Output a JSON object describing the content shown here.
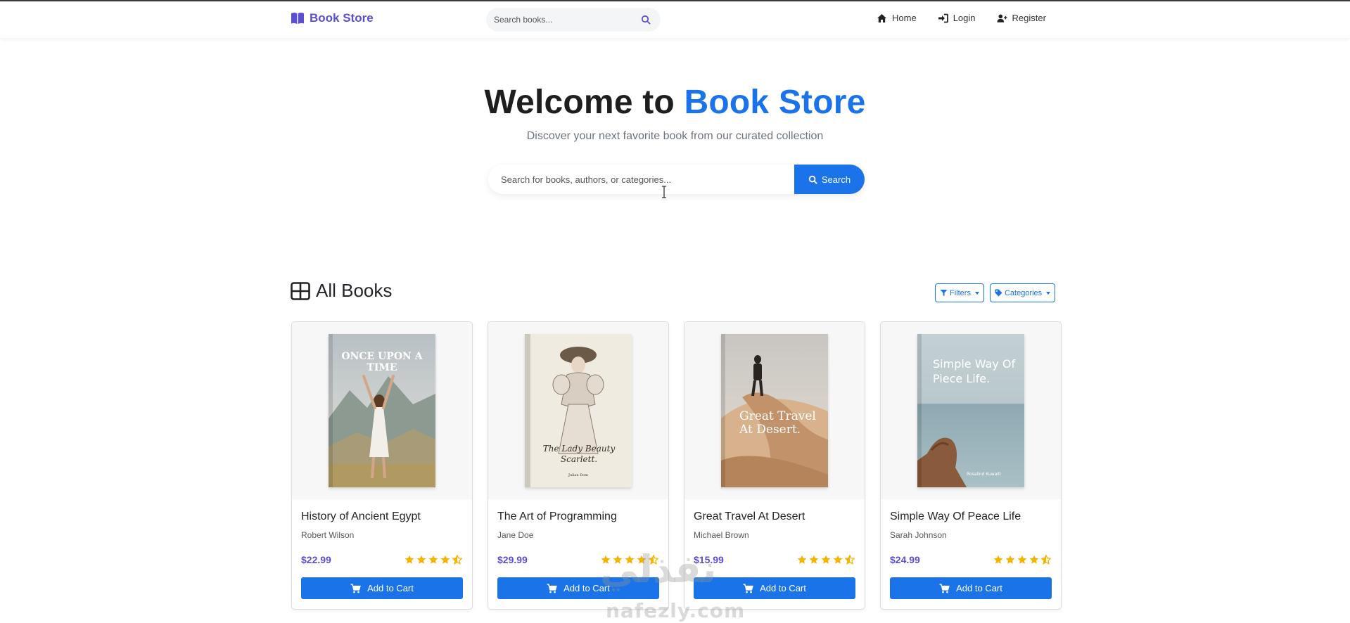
{
  "nav": {
    "brand": "Book Store",
    "search_placeholder": "Search books...",
    "links": [
      {
        "label": "Home",
        "icon": "home-icon"
      },
      {
        "label": "Login",
        "icon": "login-icon"
      },
      {
        "label": "Register",
        "icon": "user-plus-icon"
      }
    ]
  },
  "hero": {
    "title_prefix": "Welcome to ",
    "title_accent": "Book Store",
    "subtitle": "Discover your next favorite book from our curated collection",
    "search_placeholder": "Search for books, authors, or categories...",
    "search_button": "Search"
  },
  "section": {
    "title": "All Books",
    "filters_label": "Filters",
    "categories_label": "Categories"
  },
  "books": [
    {
      "title": "History of Ancient Egypt",
      "author": "Robert Wilson",
      "price": "$22.99",
      "rating": 4.5,
      "cover_text": "ONCE UPON A TIME",
      "button": "Add to Cart"
    },
    {
      "title": "The Art of Programming",
      "author": "Jane Doe",
      "price": "$29.99",
      "rating": 4.5,
      "cover_text": "The Lady Beauty Scarlett.",
      "cover_small": "Julian Dom",
      "button": "Add to Cart"
    },
    {
      "title": "Great Travel At Desert",
      "author": "Michael Brown",
      "price": "$15.99",
      "rating": 4.5,
      "cover_text": "Great Travel At Desert.",
      "button": "Add to Cart"
    },
    {
      "title": "Simple Way Of Peace Life",
      "author": "Sarah Johnson",
      "price": "$24.99",
      "rating": 4.5,
      "cover_text": "Simple Way Of Piece Life.",
      "cover_small": "Rosalind Kuwaiti",
      "button": "Add to Cart"
    }
  ],
  "colors": {
    "accent": "#1a73e8",
    "brand": "#5a4fcf",
    "star": "#f5b301"
  },
  "watermark": {
    "arabic": "نفذلي",
    "latin": "nafezly.com"
  }
}
